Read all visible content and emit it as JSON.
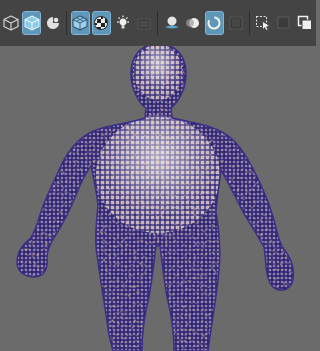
{
  "toolbar": {
    "buttons": [
      {
        "icon": "wireframe-cube-icon",
        "active": false
      },
      {
        "icon": "smooth-shade-cube-icon",
        "active": true
      },
      {
        "icon": "default-material-icon",
        "active": false
      },
      {
        "icon": "wireframe-on-shaded-icon",
        "active": true
      },
      {
        "icon": "xray-checker-icon",
        "active": true
      },
      {
        "icon": "use-all-lights-icon",
        "active": false
      },
      {
        "icon": "shadows-icon",
        "active": false
      },
      {
        "icon": "ambient-occlusion-icon",
        "active": false
      },
      {
        "icon": "motion-blur-icon",
        "active": false
      },
      {
        "icon": "anti-aliasing-icon",
        "active": false
      },
      {
        "icon": "depth-of-field-icon",
        "active": true
      },
      {
        "icon": "isolate-select-icon",
        "active": false
      },
      {
        "icon": "xray-joints-icon",
        "active": false
      },
      {
        "icon": "camera-gate-icon",
        "active": false
      }
    ]
  },
  "viewport": {
    "background": "#6b6b6b",
    "mesh_wire_color": "#3b2f8c",
    "mesh_highlight_color": "#e8a042",
    "mesh_skin_color": "#c9b7c4"
  }
}
